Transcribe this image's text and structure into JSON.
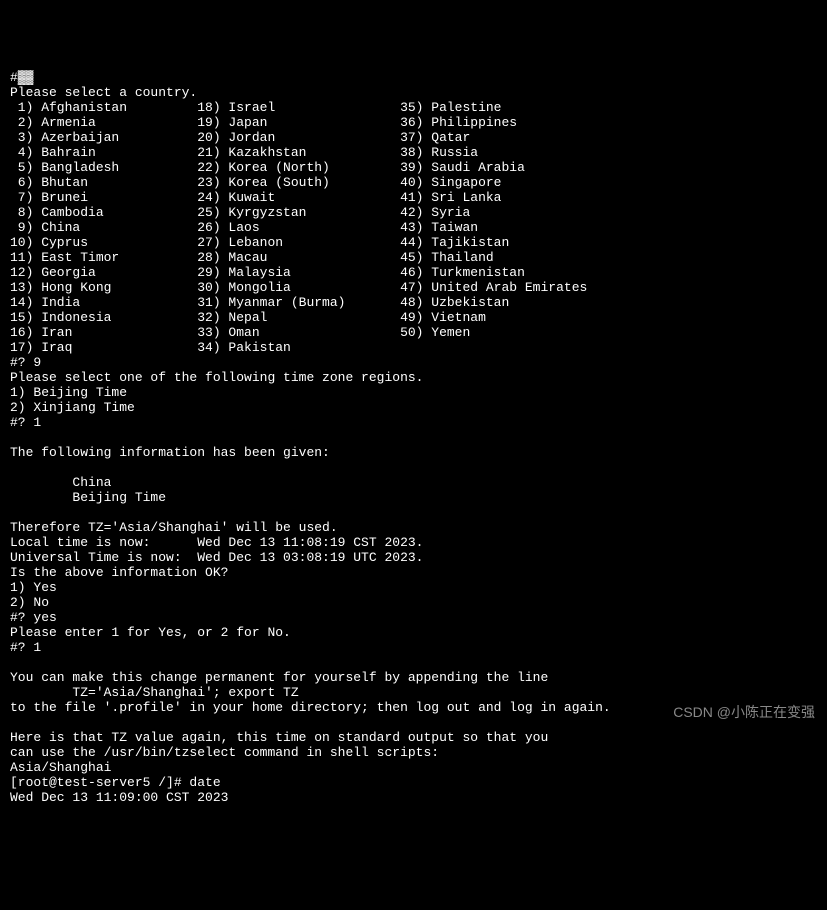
{
  "top_scrubbed": "#▓▓",
  "select_country_prompt": "Please select a country.",
  "countries": [
    [
      " 1) Afghanistan",
      "18) Israel",
      "35) Palestine"
    ],
    [
      " 2) Armenia",
      "19) Japan",
      "36) Philippines"
    ],
    [
      " 3) Azerbaijan",
      "20) Jordan",
      "37) Qatar"
    ],
    [
      " 4) Bahrain",
      "21) Kazakhstan",
      "38) Russia"
    ],
    [
      " 5) Bangladesh",
      "22) Korea (North)",
      "39) Saudi Arabia"
    ],
    [
      " 6) Bhutan",
      "23) Korea (South)",
      "40) Singapore"
    ],
    [
      " 7) Brunei",
      "24) Kuwait",
      "41) Sri Lanka"
    ],
    [
      " 8) Cambodia",
      "25) Kyrgyzstan",
      "42) Syria"
    ],
    [
      " 9) China",
      "26) Laos",
      "43) Taiwan"
    ],
    [
      "10) Cyprus",
      "27) Lebanon",
      "44) Tajikistan"
    ],
    [
      "11) East Timor",
      "28) Macau",
      "45) Thailand"
    ],
    [
      "12) Georgia",
      "29) Malaysia",
      "46) Turkmenistan"
    ],
    [
      "13) Hong Kong",
      "30) Mongolia",
      "47) United Arab Emirates"
    ],
    [
      "14) India",
      "31) Myanmar (Burma)",
      "48) Uzbekistan"
    ],
    [
      "15) Indonesia",
      "32) Nepal",
      "49) Vietnam"
    ],
    [
      "16) Iran",
      "33) Oman",
      "50) Yemen"
    ],
    [
      "17) Iraq",
      "34) Pakistan",
      ""
    ]
  ],
  "input1": "#? 9",
  "select_tz_prompt": "Please select one of the following time zone regions.",
  "tz_options": [
    "1) Beijing Time",
    "2) Xinjiang Time"
  ],
  "input2": "#? 1",
  "info_given_header": "The following information has been given:",
  "info_given_lines": [
    "        China",
    "        Beijing Time"
  ],
  "therefore_line": "Therefore TZ='Asia/Shanghai' will be used.",
  "local_time_line": "Local time is now:      Wed Dec 13 11:08:19 CST 2023.",
  "utc_time_line": "Universal Time is now:  Wed Dec 13 03:08:19 UTC 2023.",
  "confirm_prompt": "Is the above information OK?",
  "confirm_options": [
    "1) Yes",
    "2) No"
  ],
  "input3": "#? yes",
  "reprompt": "Please enter 1 for Yes, or 2 for No.",
  "input4": "#? 1",
  "permanent_lines": [
    "You can make this change permanent for yourself by appending the line",
    "        TZ='Asia/Shanghai'; export TZ",
    "to the file '.profile' in your home directory; then log out and log in again."
  ],
  "final_lines": [
    "Here is that TZ value again, this time on standard output so that you",
    "can use the /usr/bin/tzselect command in shell scripts:",
    "Asia/Shanghai"
  ],
  "shell_prompt": "[root@test-server5 /]# date",
  "date_output": "Wed Dec 13 11:09:00 CST 2023",
  "watermark": "CSDN @小陈正在变强"
}
